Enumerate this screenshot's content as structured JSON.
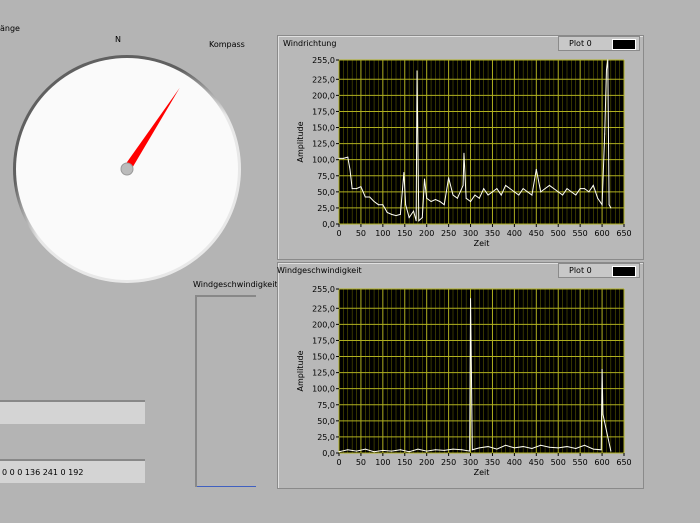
{
  "labels": {
    "top_left": "änge",
    "compass_n": "N",
    "compass_title": "Kompass",
    "speed_indicator": "Windgeschwindigkeit"
  },
  "compass": {
    "direction_deg": 33,
    "needle_color": "#ff0000"
  },
  "text_boxes": [
    {
      "value": ""
    },
    {
      "value": "0 0 0 136 241 0 192"
    }
  ],
  "speed_indicator": {
    "fill_fraction": 0.0
  },
  "chart_data": [
    {
      "type": "line",
      "title": "Windrichtung",
      "legend": "Plot 0",
      "xlabel": "Zeit",
      "ylabel": "Amplitude",
      "xlim": [
        0,
        650
      ],
      "ylim": [
        0,
        255
      ],
      "xticks": [
        "0",
        "50",
        "100",
        "150",
        "200",
        "250",
        "300",
        "350",
        "400",
        "450",
        "500",
        "550",
        "600",
        "650"
      ],
      "yticks": [
        "0,0",
        "25,0",
        "50,0",
        "75,0",
        "100,0",
        "125,0",
        "150,0",
        "175,0",
        "200,0",
        "225,0",
        "255,0"
      ],
      "series": [
        {
          "name": "Plot 0",
          "x": [
            0,
            10,
            20,
            25,
            30,
            40,
            50,
            60,
            70,
            80,
            90,
            100,
            110,
            120,
            130,
            140,
            148,
            152,
            160,
            170,
            176,
            178,
            182,
            190,
            195,
            200,
            210,
            220,
            230,
            240,
            250,
            260,
            270,
            283,
            285,
            290,
            300,
            310,
            320,
            330,
            340,
            350,
            360,
            370,
            380,
            390,
            400,
            410,
            420,
            430,
            440,
            450,
            460,
            470,
            480,
            490,
            500,
            510,
            520,
            530,
            540,
            550,
            560,
            570,
            580,
            590,
            600,
            606,
            610,
            613,
            616,
            620
          ],
          "y": [
            102,
            102,
            104,
            85,
            55,
            55,
            58,
            42,
            42,
            35,
            30,
            30,
            18,
            15,
            13,
            15,
            80,
            30,
            10,
            20,
            5,
            238,
            5,
            10,
            70,
            40,
            35,
            38,
            35,
            30,
            72,
            45,
            40,
            60,
            110,
            40,
            35,
            45,
            40,
            55,
            45,
            50,
            55,
            45,
            60,
            55,
            50,
            45,
            55,
            50,
            45,
            85,
            50,
            55,
            60,
            55,
            50,
            45,
            55,
            50,
            45,
            55,
            55,
            50,
            60,
            40,
            30,
            140,
            240,
            255,
            30,
            25
          ]
        }
      ]
    },
    {
      "type": "line",
      "title": "Windgeschwindigkeit",
      "legend": "Plot 0",
      "xlabel": "Zeit",
      "ylabel": "Amplitude",
      "xlim": [
        0,
        650
      ],
      "ylim": [
        0,
        255
      ],
      "xticks": [
        "0",
        "50",
        "100",
        "150",
        "200",
        "250",
        "300",
        "350",
        "400",
        "450",
        "500",
        "550",
        "600",
        "650"
      ],
      "yticks": [
        "0,0",
        "25,0",
        "50,0",
        "75,0",
        "100,0",
        "125,0",
        "150,0",
        "175,0",
        "200,0",
        "225,0",
        "255,0"
      ],
      "series": [
        {
          "name": "Plot 0",
          "x": [
            0,
            20,
            40,
            60,
            80,
            100,
            120,
            140,
            160,
            180,
            200,
            220,
            240,
            260,
            280,
            298,
            300,
            302,
            304,
            320,
            340,
            360,
            380,
            400,
            420,
            440,
            460,
            480,
            500,
            520,
            540,
            560,
            580,
            598,
            600,
            602,
            620
          ],
          "y": [
            2,
            5,
            3,
            6,
            2,
            4,
            3,
            5,
            2,
            6,
            3,
            5,
            4,
            6,
            5,
            3,
            240,
            125,
            5,
            8,
            10,
            6,
            12,
            8,
            10,
            7,
            12,
            9,
            8,
            10,
            7,
            12,
            6,
            5,
            130,
            60,
            3
          ]
        }
      ]
    }
  ]
}
